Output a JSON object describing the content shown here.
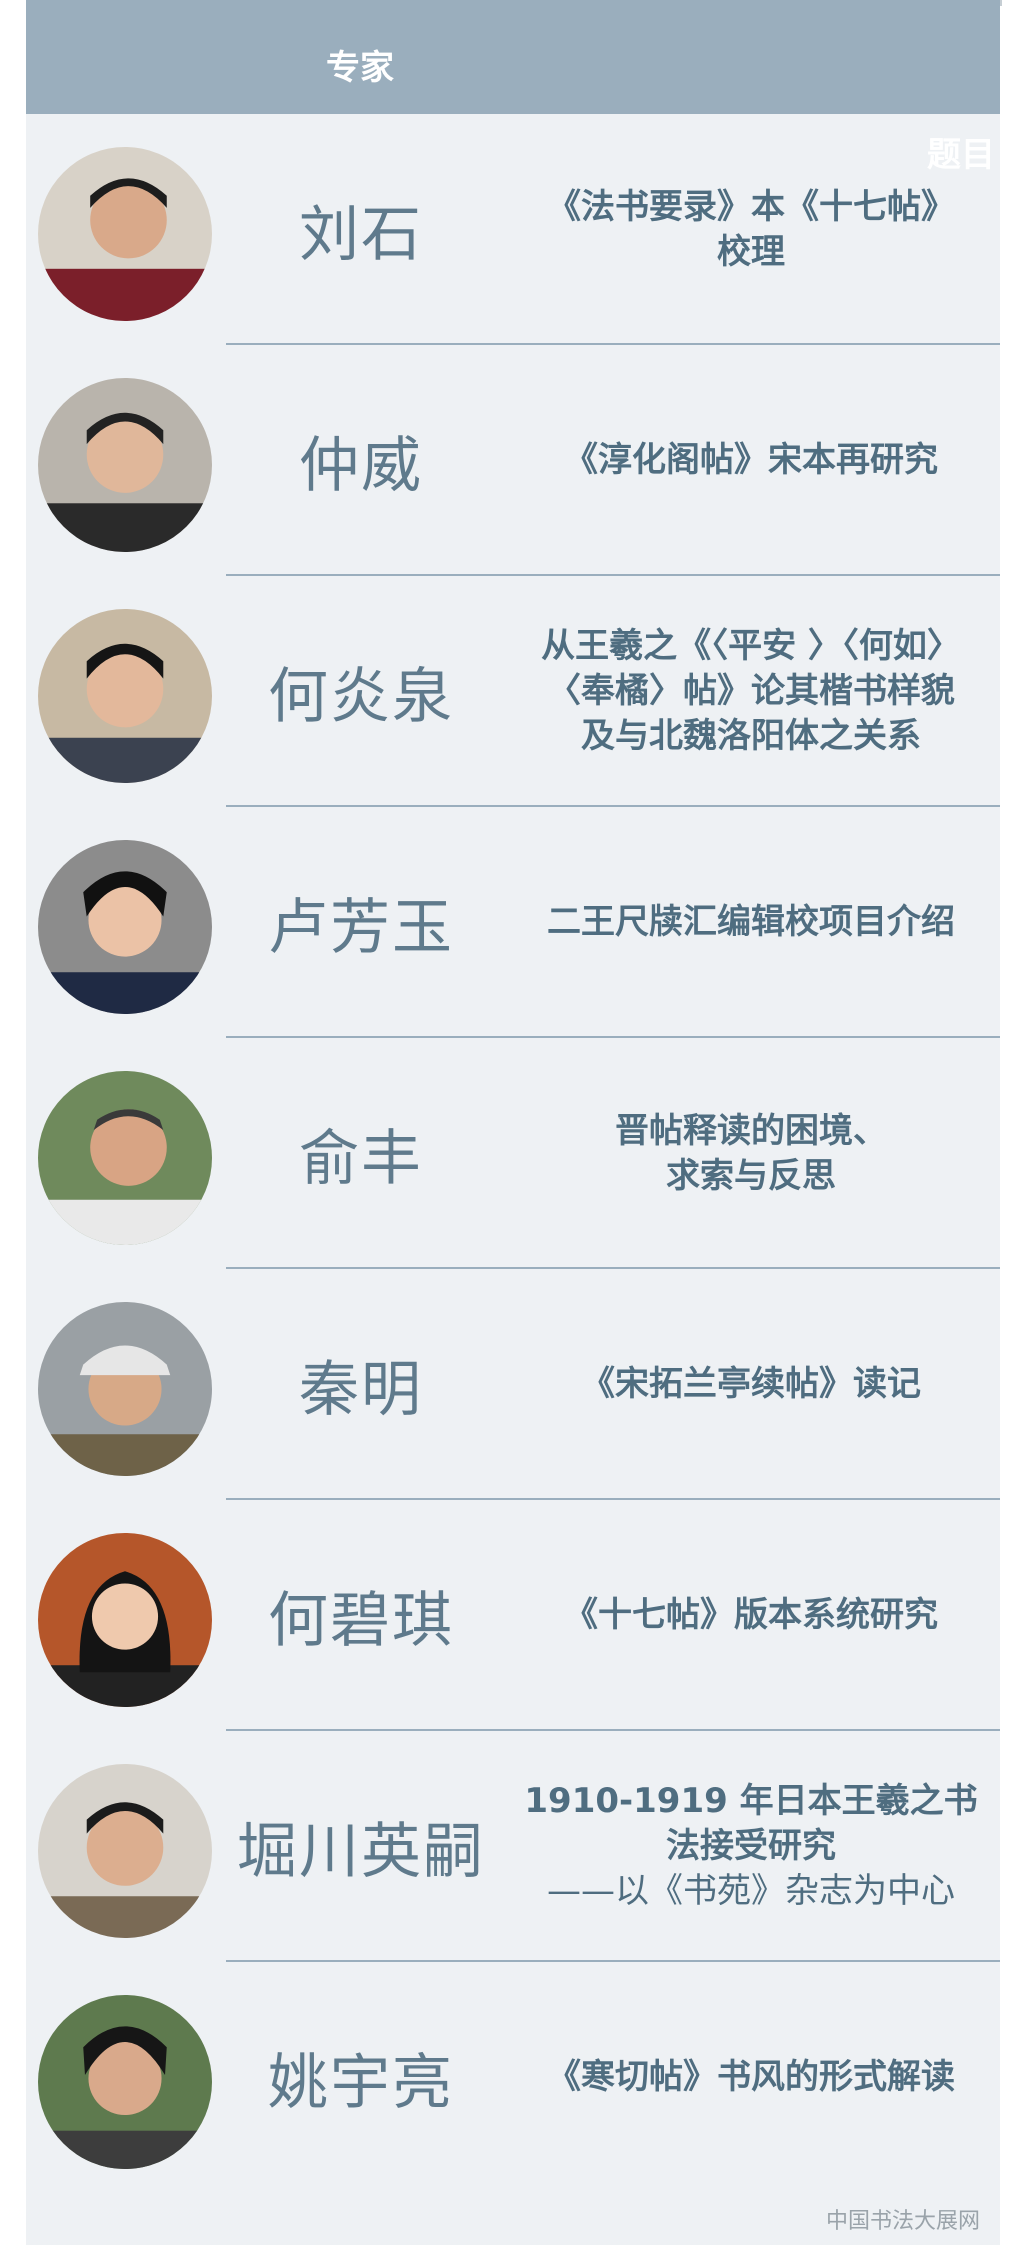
{
  "header": {
    "expert": "专家",
    "topic": "题目"
  },
  "rows": [
    {
      "name": "刘石",
      "topic": [
        "《法书要录》本《十七帖》",
        "校理"
      ]
    },
    {
      "name": "仲威",
      "topic": [
        "《淳化阁帖》宋本再研究"
      ]
    },
    {
      "name": "何炎泉",
      "topic": [
        "从王羲之《〈平安 〉〈何如〉",
        "〈奉橘〉帖》论其楷书样貌",
        "及与北魏洛阳体之关系"
      ]
    },
    {
      "name": "卢芳玉",
      "topic": [
        "二王尺牍汇编辑校项目介绍"
      ]
    },
    {
      "name": "俞丰",
      "topic": [
        "晋帖释读的困境、",
        "求索与反思"
      ]
    },
    {
      "name": "秦明",
      "topic": [
        "《宋拓兰亭续帖》读记"
      ]
    },
    {
      "name": "何碧琪",
      "topic": [
        "《十七帖》版本系统研究"
      ]
    },
    {
      "name": "堀川英嗣",
      "topic": [
        "1910-1919 年日本王羲之书",
        "法接受研究"
      ],
      "subtitle": "——以《书苑》杂志为中心"
    },
    {
      "name": "姚宇亮",
      "topic": [
        "《寒切帖》书风的形式解读"
      ]
    }
  ],
  "watermark": "中国书法大展网"
}
